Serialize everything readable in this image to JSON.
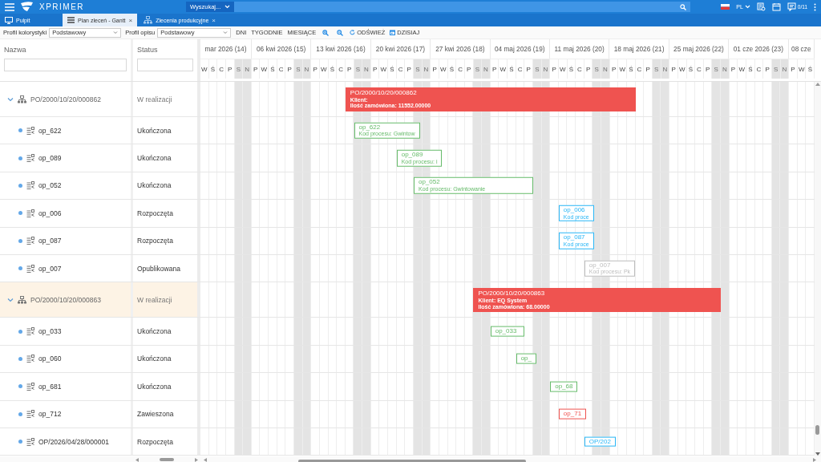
{
  "topbar": {
    "logo": "XPRIMER",
    "search_scope": "Wyszukaj...",
    "language": "PL",
    "messages": "0/11"
  },
  "tabs": [
    {
      "label": "Pulpit",
      "selected": false
    },
    {
      "label": "Plan zleceń - Gantt",
      "close": "×",
      "selected": true
    },
    {
      "label": "Zlecenia produkcyjne",
      "close": "×",
      "selected": false
    }
  ],
  "toolbar": {
    "profiles": [
      {
        "label": "Profil kolorystyki",
        "value": "Podstawowy"
      },
      {
        "label": "Profil opisu",
        "value": "Podstawowy"
      }
    ],
    "buttons": [
      {
        "kind": "text",
        "label": "DNI"
      },
      {
        "kind": "text",
        "label": "TYGODNIE"
      },
      {
        "kind": "text",
        "label": "MIESIĄCE"
      },
      {
        "kind": "zoom_in"
      },
      {
        "kind": "zoom_out"
      },
      {
        "kind": "refresh",
        "label": "ODŚWIEŻ"
      },
      {
        "kind": "today",
        "label": "DZISIAJ"
      }
    ]
  },
  "columns": [
    {
      "label": "Nazwa"
    },
    {
      "label": "Status"
    }
  ],
  "timeline": {
    "weeks": [
      {
        "label": "mar 2026 (14)",
        "days": [
          {
            "label": "W",
            "weekend": false
          },
          {
            "label": "Ś",
            "weekend": false
          },
          {
            "label": "C",
            "weekend": false
          },
          {
            "label": "P",
            "weekend": false
          },
          {
            "label": "S",
            "weekend": true
          },
          {
            "label": "N",
            "weekend": true
          }
        ]
      },
      {
        "label": "06 kwi 2026 (15)",
        "days": [
          {
            "label": "P",
            "weekend": false
          },
          {
            "label": "W",
            "weekend": false
          },
          {
            "label": "Ś",
            "weekend": false
          },
          {
            "label": "C",
            "weekend": false
          },
          {
            "label": "P",
            "weekend": false
          },
          {
            "label": "S",
            "weekend": true
          },
          {
            "label": "N",
            "weekend": true
          }
        ]
      },
      {
        "label": "13 kwi 2026 (16)",
        "days": [
          {
            "label": "P",
            "weekend": false
          },
          {
            "label": "W",
            "weekend": false
          },
          {
            "label": "Ś",
            "weekend": false
          },
          {
            "label": "C",
            "weekend": false
          },
          {
            "label": "P",
            "weekend": false
          },
          {
            "label": "S",
            "weekend": true
          },
          {
            "label": "N",
            "weekend": true
          }
        ]
      },
      {
        "label": "20 kwi 2026 (17)",
        "days": [
          {
            "label": "P",
            "weekend": false
          },
          {
            "label": "W",
            "weekend": false
          },
          {
            "label": "Ś",
            "weekend": false
          },
          {
            "label": "C",
            "weekend": false
          },
          {
            "label": "P",
            "weekend": false
          },
          {
            "label": "S",
            "weekend": true
          },
          {
            "label": "N",
            "weekend": true
          }
        ]
      },
      {
        "label": "27 kwi 2026 (18)",
        "days": [
          {
            "label": "P",
            "weekend": false
          },
          {
            "label": "W",
            "weekend": false
          },
          {
            "label": "Ś",
            "weekend": false
          },
          {
            "label": "C",
            "weekend": false
          },
          {
            "label": "P",
            "weekend": false
          },
          {
            "label": "S",
            "weekend": true
          },
          {
            "label": "N",
            "weekend": true
          }
        ]
      },
      {
        "label": "04 maj 2026 (19)",
        "days": [
          {
            "label": "P",
            "weekend": false
          },
          {
            "label": "W",
            "weekend": false
          },
          {
            "label": "Ś",
            "weekend": false
          },
          {
            "label": "C",
            "weekend": false
          },
          {
            "label": "P",
            "weekend": false
          },
          {
            "label": "S",
            "weekend": true
          },
          {
            "label": "N",
            "weekend": true
          }
        ]
      },
      {
        "label": "11 maj 2026 (20)",
        "days": [
          {
            "label": "P",
            "weekend": false
          },
          {
            "label": "W",
            "weekend": false
          },
          {
            "label": "Ś",
            "weekend": false
          },
          {
            "label": "C",
            "weekend": false
          },
          {
            "label": "P",
            "weekend": false
          },
          {
            "label": "S",
            "weekend": true
          },
          {
            "label": "N",
            "weekend": true
          }
        ]
      },
      {
        "label": "18 maj 2026 (21)",
        "days": [
          {
            "label": "P",
            "weekend": false
          },
          {
            "label": "W",
            "weekend": false
          },
          {
            "label": "Ś",
            "weekend": false
          },
          {
            "label": "C",
            "weekend": false
          },
          {
            "label": "P",
            "weekend": false
          },
          {
            "label": "S",
            "weekend": true
          },
          {
            "label": "N",
            "weekend": true
          }
        ]
      },
      {
        "label": "25 maj 2026 (22)",
        "days": [
          {
            "label": "P",
            "weekend": false
          },
          {
            "label": "W",
            "weekend": false
          },
          {
            "label": "Ś",
            "weekend": false
          },
          {
            "label": "C",
            "weekend": false
          },
          {
            "label": "P",
            "weekend": false
          },
          {
            "label": "S",
            "weekend": true
          },
          {
            "label": "N",
            "weekend": true
          }
        ]
      },
      {
        "label": "01 cze 2026 (23)",
        "days": [
          {
            "label": "P",
            "weekend": false
          },
          {
            "label": "W",
            "weekend": false
          },
          {
            "label": "Ś",
            "weekend": false
          },
          {
            "label": "C",
            "weekend": false
          },
          {
            "label": "P",
            "weekend": false
          },
          {
            "label": "S",
            "weekend": true
          },
          {
            "label": "N",
            "weekend": true
          }
        ]
      },
      {
        "label": "08 cze",
        "days": [
          {
            "label": "P",
            "weekend": false
          },
          {
            "label": "W",
            "weekend": false
          },
          {
            "label": "Ś",
            "weekend": false
          }
        ]
      }
    ]
  },
  "rows": [
    {
      "name": "PO/2000/10/20/000862",
      "status": "W realizacji",
      "expanded": true,
      "selected": false,
      "bar": {
        "kind": "order",
        "color": "#ef5350",
        "lines": [
          "PO/2000/10/20/000862",
          "Klient:",
          "Ilość zamówiona: 11552.00000"
        ]
      },
      "children": [
        {
          "name": "op_622",
          "status": "Ukończona",
          "selected": false,
          "bar": {
            "kind": "operation",
            "color": "#66bb6a",
            "lines": [
              "op_622",
              "Kod procesu: Gwintow"
            ]
          }
        },
        {
          "name": "op_089",
          "status": "Ukończona",
          "selected": false,
          "bar": {
            "kind": "operation",
            "color": "#66bb6a",
            "lines": [
              "op_089",
              "Kod procesu: i"
            ]
          }
        },
        {
          "name": "op_052",
          "status": "Ukończona",
          "selected": false,
          "bar": {
            "kind": "operation",
            "color": "#66bb6a",
            "lines": [
              "op_052",
              "Kod procesu: Gwintowanie"
            ]
          }
        },
        {
          "name": "op_006",
          "status": "Rozpoczęta",
          "selected": false,
          "bar": {
            "kind": "operation",
            "color": "#29b6f6",
            "lines": [
              "op_006",
              "Kod proce"
            ]
          }
        },
        {
          "name": "op_087",
          "status": "Rozpoczęta",
          "selected": false,
          "bar": {
            "kind": "operation",
            "color": "#29b6f6",
            "lines": [
              "op_087",
              "Kod proce"
            ]
          }
        },
        {
          "name": "op_007",
          "status": "Opublikowana",
          "selected": false,
          "bar": {
            "kind": "operation",
            "color": "#bdbdbd",
            "lines": [
              "op_007",
              "Kod procesu: Pk"
            ]
          }
        }
      ]
    },
    {
      "name": "PO/2000/10/20/000863",
      "status": "W realizacji",
      "expanded": true,
      "selected": true,
      "bar": {
        "kind": "order",
        "color": "#ef5350",
        "lines": [
          "PO/2000/10/20/000863",
          "Klient: EQ System",
          "Ilość zamówiona: 68.00000"
        ]
      },
      "children": [
        {
          "name": "op_033",
          "status": "Ukończona",
          "selected": false,
          "bar": {
            "kind": "operation",
            "color": "#66bb6a",
            "lines": [
              "op_033"
            ]
          }
        },
        {
          "name": "op_060",
          "status": "Ukończona",
          "selected": false,
          "bar": {
            "kind": "operation",
            "color": "#66bb6a",
            "lines": [
              "op_"
            ]
          }
        },
        {
          "name": "op_681",
          "status": "Ukończona",
          "selected": false,
          "bar": {
            "kind": "operation",
            "color": "#66bb6a",
            "lines": [
              "op_68"
            ]
          }
        },
        {
          "name": "op_712",
          "status": "Zawieszona",
          "selected": false,
          "bar": {
            "kind": "operation",
            "color": "#ef5350",
            "lines": [
              "op_71"
            ]
          }
        },
        {
          "name": "OP/2026/04/28/000001",
          "status": "Rozpoczęta",
          "selected": false,
          "bar": {
            "kind": "operation",
            "color": "#29b6f6",
            "lines": [
              "OP/202"
            ]
          }
        }
      ]
    }
  ]
}
